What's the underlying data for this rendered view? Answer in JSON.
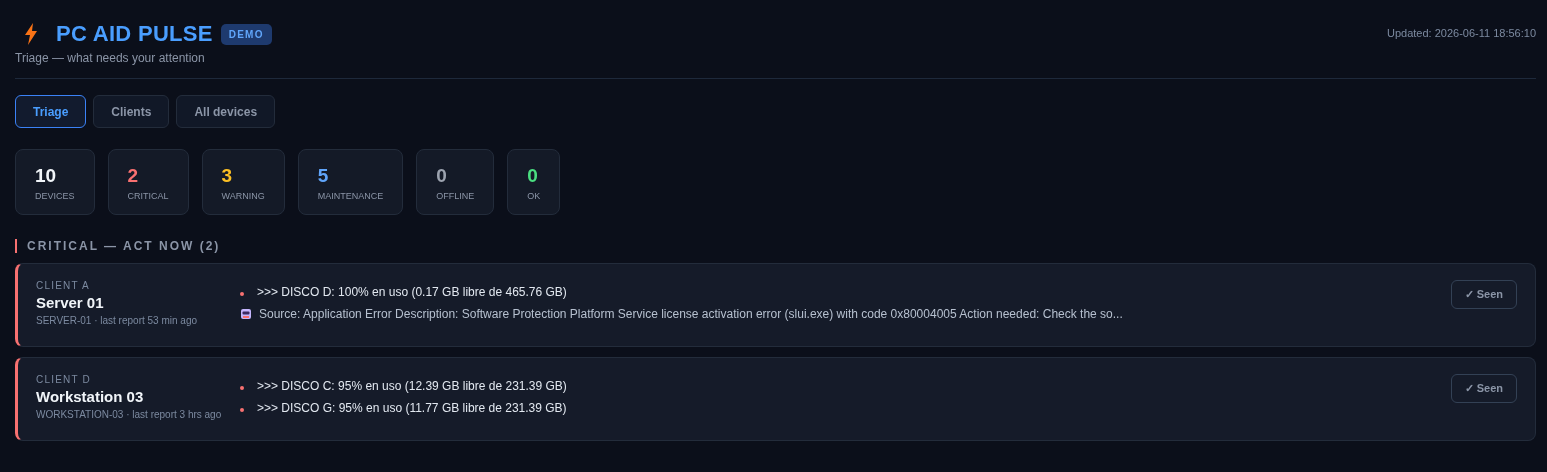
{
  "header": {
    "title": "PC AID PULSE",
    "badge": "DEMO",
    "subtitle": "Triage — what needs your attention",
    "updated": "Updated: 2026-06-11 18:56:10"
  },
  "tabs": [
    {
      "label": "Triage",
      "selected": true
    },
    {
      "label": "Clients",
      "selected": false
    },
    {
      "label": "All devices",
      "selected": false
    }
  ],
  "stats": [
    {
      "value": "10",
      "label": "DEVICES",
      "color": "#f1f5f9"
    },
    {
      "value": "2",
      "label": "CRITICAL",
      "color": "#f87171"
    },
    {
      "value": "3",
      "label": "WARNING",
      "color": "#fbbf24"
    },
    {
      "value": "5",
      "label": "MAINTENANCE",
      "color": "#60a5fa"
    },
    {
      "value": "0",
      "label": "OFFLINE",
      "color": "#9ca3af"
    },
    {
      "value": "0",
      "label": "OK",
      "color": "#4ade80"
    }
  ],
  "section": {
    "title": "CRITICAL — ACT NOW (2)"
  },
  "devices": [
    {
      "client": "CLIENT A",
      "name": "Server 01",
      "meta": "SERVER-01 · last report 53 min ago",
      "button": "✓ Seen",
      "issues": [
        {
          "kind": "bullet",
          "text": ">>> DISCO D: 100% en uso (0.17 GB libre de 465.76 GB)"
        },
        {
          "kind": "event",
          "text": "Source: Application Error Description: Software Protection Platform Service license activation error (slui.exe) with code 0x80004005 Action needed: Check the so..."
        }
      ]
    },
    {
      "client": "CLIENT D",
      "name": "Workstation 03",
      "meta": "WORKSTATION-03 · last report 3 hrs ago",
      "button": "✓ Seen",
      "issues": [
        {
          "kind": "bullet",
          "text": ">>> DISCO C: 95% en uso (12.39 GB libre de 231.39 GB)"
        },
        {
          "kind": "bullet",
          "text": ">>> DISCO G: 95% en uso (11.77 GB libre de 231.39 GB)"
        }
      ]
    }
  ]
}
